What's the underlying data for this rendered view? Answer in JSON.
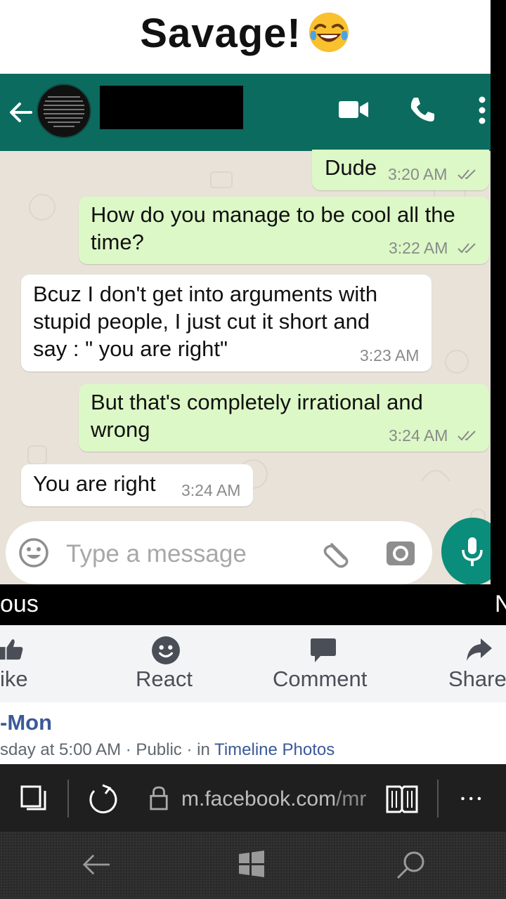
{
  "meme": {
    "title": "Savage!",
    "emoji": "tears-of-joy-emoji"
  },
  "chat": {
    "contact_name": "",
    "input_placeholder": "Type a message",
    "messages": [
      {
        "direction": "outgoing",
        "text": "Dude",
        "time": "3:20 AM",
        "read": true
      },
      {
        "direction": "outgoing",
        "lines": [
          "How do you manage to be cool all the",
          "time?"
        ],
        "time": "3:22 AM",
        "read": true
      },
      {
        "direction": "incoming",
        "lines": [
          "Bcuz I don't get into arguments with",
          "stupid people, I just cut it short and",
          "say : \" you are right\""
        ],
        "time": "3:23 AM"
      },
      {
        "direction": "outgoing",
        "lines": [
          "But that's completely irrational and",
          "wrong"
        ],
        "time": "3:24 AM",
        "read": true
      },
      {
        "direction": "incoming",
        "text": "You are right",
        "time": "3:24 AM"
      }
    ],
    "icons": [
      "back-arrow-icon",
      "video-call-icon",
      "phone-icon",
      "more-menu-icon",
      "emoji-icon",
      "attach-icon",
      "camera-icon",
      "mic-icon"
    ],
    "colors": {
      "header": "#0b6b5e",
      "outgoing": "#dcf8c6",
      "incoming": "#ffffff",
      "mic": "#0a8d7a"
    }
  },
  "strip": {
    "left_text": "ous",
    "right_text": "N"
  },
  "fb": {
    "actions": [
      {
        "label": "ike",
        "icon": "like-icon"
      },
      {
        "label": "React",
        "icon": "react-icon"
      },
      {
        "label": "Comment",
        "icon": "comment-icon"
      },
      {
        "label": "Share",
        "icon": "share-icon"
      }
    ],
    "author": "-Mon",
    "sub_prefix": "sday at 5:00 AM · Public · in ",
    "sub_link": "Timeline Photos",
    "colors": {
      "link": "#3b5998"
    }
  },
  "browser": {
    "url_host": "m.facebook.com",
    "url_path": "/mr",
    "icons": [
      "tabs-icon",
      "refresh-icon",
      "lock-icon",
      "reading-view-icon",
      "more-icon"
    ]
  },
  "system_nav": {
    "icons": [
      "back-icon",
      "windows-start-icon",
      "search-icon"
    ]
  }
}
